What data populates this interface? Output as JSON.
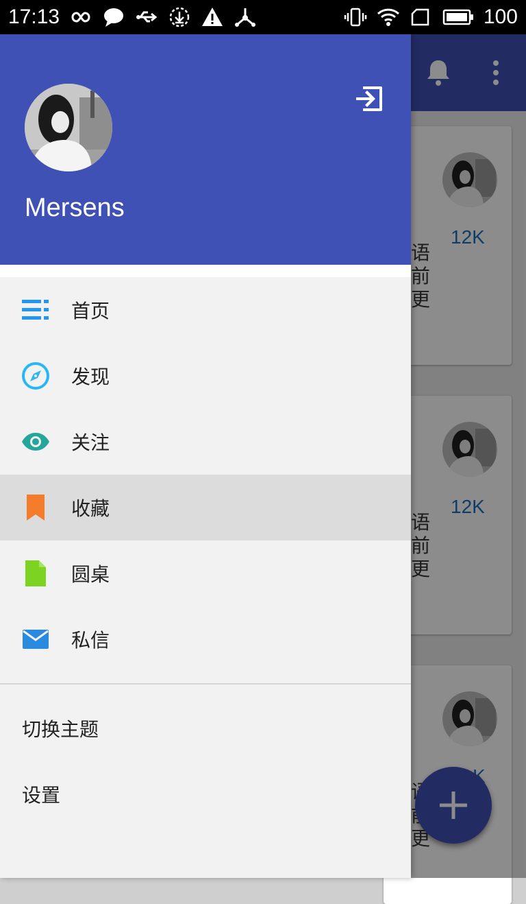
{
  "status_bar": {
    "time": "17:13",
    "battery": "100",
    "left_icons": [
      "infinity-icon",
      "chat-bubble-icon",
      "usb-icon",
      "download-icon",
      "warning-icon",
      "share-icon"
    ],
    "right_icons": [
      "vibrate-icon",
      "wifi-icon",
      "sim-icon",
      "battery-icon"
    ]
  },
  "drawer": {
    "username": "Mersens",
    "accent_color": "#3f51b5",
    "menu": [
      {
        "label": "首页",
        "icon": "list-icon",
        "color": "#2196f3",
        "selected": false
      },
      {
        "label": "发现",
        "icon": "compass-icon",
        "color": "#29b6f6",
        "selected": false
      },
      {
        "label": "关注",
        "icon": "eye-icon",
        "color": "#26a69a",
        "selected": false
      },
      {
        "label": "收藏",
        "icon": "bookmark-icon",
        "color": "#f57c2b",
        "selected": true
      },
      {
        "label": "圆桌",
        "icon": "document-icon",
        "color": "#7cd321",
        "selected": false
      },
      {
        "label": "私信",
        "icon": "mail-icon",
        "color": "#2a8ae0",
        "selected": false
      }
    ],
    "secondary_menu": [
      {
        "label": "切换主题"
      },
      {
        "label": "设置"
      }
    ]
  },
  "background": {
    "toolbar_icons": [
      "bell-icon",
      "more-vert-icon"
    ],
    "cards": [
      {
        "count": "12K",
        "snippet": "语\n前\n更"
      },
      {
        "count": "12K",
        "snippet": "语\n前\n更"
      },
      {
        "count": "K",
        "snippet": "语\n前\n更"
      }
    ],
    "fab_icon": "plus-icon"
  }
}
